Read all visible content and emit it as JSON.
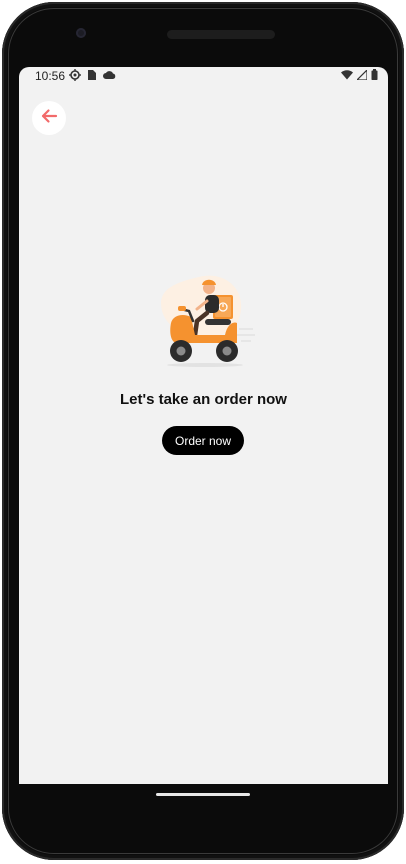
{
  "status_bar": {
    "time": "10:56",
    "left_icons": [
      "settings-gear-icon",
      "sim-card-icon",
      "cloud-icon"
    ],
    "right_icons": [
      "wifi-icon",
      "cell-signal-icon",
      "battery-icon"
    ]
  },
  "header": {
    "back_icon": "arrow-left-icon",
    "accent_color": "#f26a6a"
  },
  "empty_state": {
    "illustration": "delivery-scooter-illustration",
    "title": "Let's take an order now",
    "button_label": "Order now"
  },
  "colors": {
    "screen_background": "#f2f2f2",
    "button_background": "#000000",
    "button_text": "#ffffff",
    "illustration_orange": "#f5922f"
  }
}
